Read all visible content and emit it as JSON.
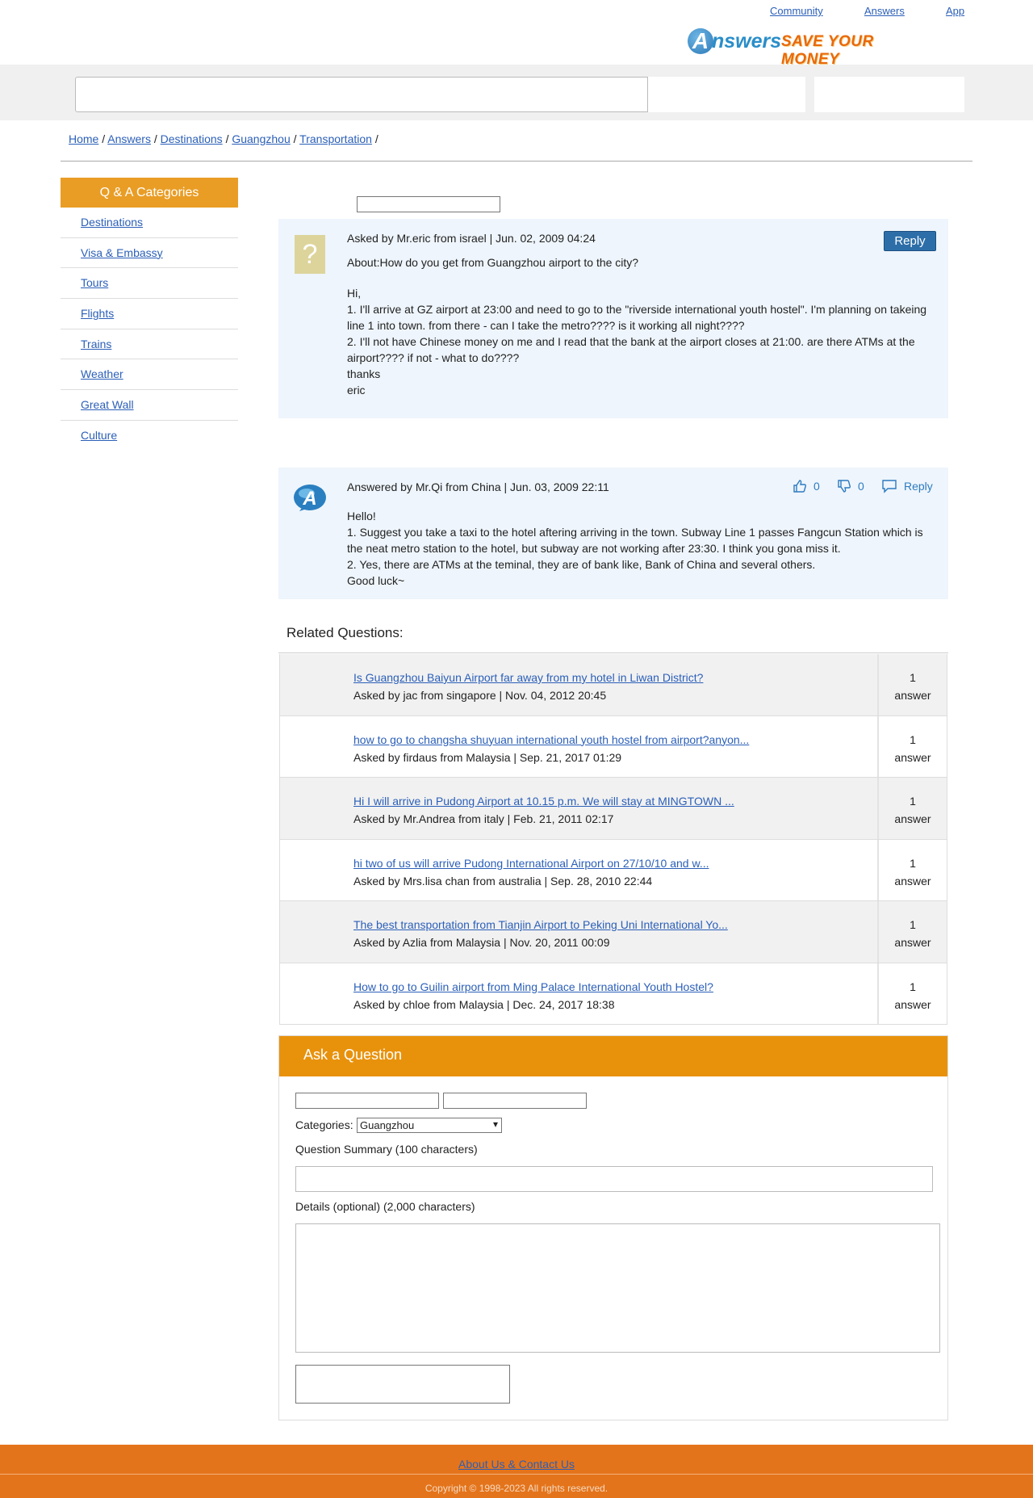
{
  "topnav": {
    "community": "Community",
    "answers": "Answers",
    "app": "App"
  },
  "logo": {
    "badge": "A",
    "word": "nswers",
    "tagline": "SAVE YOUR MONEY"
  },
  "breadcrumb": [
    "Home",
    "Answers",
    "Destinations",
    "Guangzhou",
    "Transportation"
  ],
  "sidebar": {
    "title": "Q & A Categories",
    "items": [
      "Destinations",
      "Visa & Embassy",
      "Tours",
      "Flights",
      "Trains",
      "Weather",
      "Great Wall",
      "Culture"
    ]
  },
  "question": {
    "avatar": "?",
    "meta": "Asked by Mr.eric from israel | Jun. 02, 2009 04:24",
    "about": "About:How do you get from Guangzhou airport to the city?",
    "reply": "Reply",
    "body": [
      "Hi,",
      "1. I'll arrive at GZ airport at 23:00 and need to go to the \"riverside international youth hostel\". I'm planning on takeing line 1 into town. from there - can I take the metro???? is it working all night????",
      "2. I'll not have Chinese money on me and I read that the bank at the airport closes at 21:00. are there ATMs at the airport???? if not - what to do????",
      "thanks",
      "eric"
    ]
  },
  "answer": {
    "meta": "Answered by Mr.Qi from China | Jun. 03, 2009 22:11",
    "likes": "0",
    "dislikes": "0",
    "reply": "Reply",
    "body": [
      "Hello!",
      "1. Suggest you take a taxi to the hotel aftering arriving in the town. Subway Line 1 passes Fangcun Station which is the neat metro station to the hotel, but subway are not working after 23:30. I think you gona miss it.",
      "2. Yes, there are ATMs at the teminal, they are of bank like, Bank of China and several others.",
      "Good luck~"
    ]
  },
  "related": {
    "title": "Related Questions:",
    "items": [
      {
        "link": "Is Guangzhou Baiyun Airport far away from my hotel in Liwan District?",
        "meta": "Asked by jac from singapore | Nov. 04, 2012 20:45",
        "count": "1",
        "unit": "answer"
      },
      {
        "link": "how to go to changsha shuyuan international youth hostel from airport?anyon...",
        "meta": "Asked by firdaus from Malaysia | Sep. 21, 2017 01:29",
        "count": "1",
        "unit": "answer"
      },
      {
        "link": "Hi I will arrive in Pudong Airport at 10.15 p.m. We will stay at MINGTOWN ...",
        "meta": "Asked by Mr.Andrea from italy | Feb. 21, 2011 02:17",
        "count": "1",
        "unit": "answer"
      },
      {
        "link": "hi two of us will arrive Pudong International Airport on 27/10/10 and w...",
        "meta": "Asked by Mrs.lisa chan from australia | Sep. 28, 2010 22:44",
        "count": "1",
        "unit": "answer"
      },
      {
        "link": "The best transportation from Tianjin Airport to Peking Uni International Yo...",
        "meta": "Asked by Azlia from Malaysia | Nov. 20, 2011 00:09",
        "count": "1",
        "unit": "answer"
      },
      {
        "link": "How to go to Guilin airport from Ming Palace International Youth Hostel?",
        "meta": "Asked by chloe from Malaysia | Dec. 24, 2017 18:38",
        "count": "1",
        "unit": "answer"
      }
    ]
  },
  "ask": {
    "title": "Ask a Question",
    "categories_label": "Categories:",
    "category_selected": "Guangzhou",
    "summary_label": "Question Summary (100 characters)",
    "details_label": "Details (optional) (2,000 characters)"
  },
  "footer": {
    "link": "About Us & Contact Us",
    "copyright": "Copyright © 1998-2023 All rights reserved."
  },
  "colors": {
    "accent_orange": "#e99d25",
    "ask_header": "#e8920c",
    "footer": "#e4741b",
    "link": "#2b5fb8",
    "reply_button": "#2d6ea8",
    "panel_bg": "#eef5fc"
  }
}
